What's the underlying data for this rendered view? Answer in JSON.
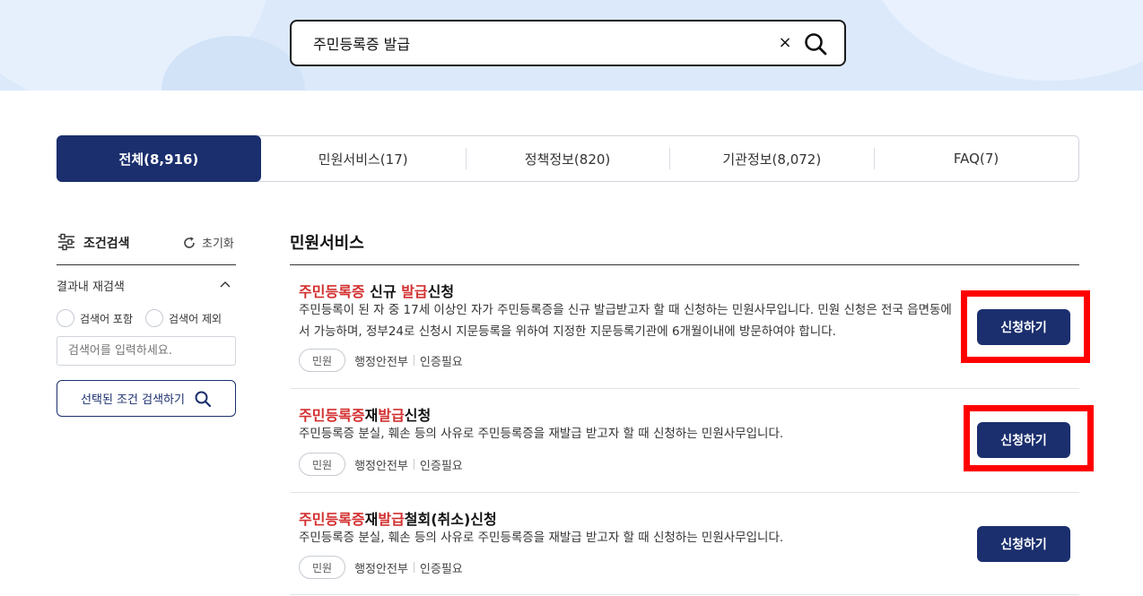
{
  "search": {
    "query": "주민등록증 발급",
    "clear_icon": "×"
  },
  "tabs": [
    {
      "label": "전체(8,916)",
      "active": true
    },
    {
      "label": "민원서비스(17)",
      "active": false
    },
    {
      "label": "정책정보(820)",
      "active": false
    },
    {
      "label": "기관정보(8,072)",
      "active": false
    },
    {
      "label": "FAQ(7)",
      "active": false
    }
  ],
  "sidebar": {
    "title": "조건검색",
    "reset_label": "초기화",
    "refine_label": "결과내 재검색",
    "radio_include": "검색어 포함",
    "radio_exclude": "검색어 제외",
    "input_placeholder": "검색어를 입력하세요.",
    "search_button": "선택된 조건 검색하기"
  },
  "section": {
    "title": "민원서비스"
  },
  "results": [
    {
      "title_parts": [
        "주민등록증",
        " 신규 ",
        "발급",
        "신청"
      ],
      "desc": "주민등록이 된 자 중 17세 이상인 자가 주민등록증을 신규 발급받고자 할 때 신청하는 민원사무입니다. 민원 신청은 전국 읍면동에서 가능하며, 정부24로 신청시 지문등록을 위하여 지정한 지문등록기관에 6개월이내에 방문하여야 합니다.",
      "tag": "민원",
      "agency": "행정안전부",
      "auth": "인증필요",
      "button": "신청하기"
    },
    {
      "title_parts": [
        "주민등록증",
        "재",
        "발급",
        "신청"
      ],
      "desc": "주민등록증 분실, 훼손 등의 사유로 주민등록증을 재발급 받고자 할 때 신청하는 민원사무입니다.",
      "tag": "민원",
      "agency": "행정안전부",
      "auth": "인증필요",
      "button": "신청하기"
    },
    {
      "title_parts": [
        "주민등록증",
        "재",
        "발급",
        "철회(취소)신청"
      ],
      "desc": "주민등록증 분실, 훼손 등의 사유로 주민등록증을 재발급 받고자 할 때 신청하는 민원사무입니다.",
      "tag": "민원",
      "agency": "행정안전부",
      "auth": "인증필요",
      "button": "신청하기"
    }
  ],
  "colors": {
    "primary": "#1b2f6e",
    "highlight": "#d32f2f",
    "annotation": "#ff0000"
  }
}
